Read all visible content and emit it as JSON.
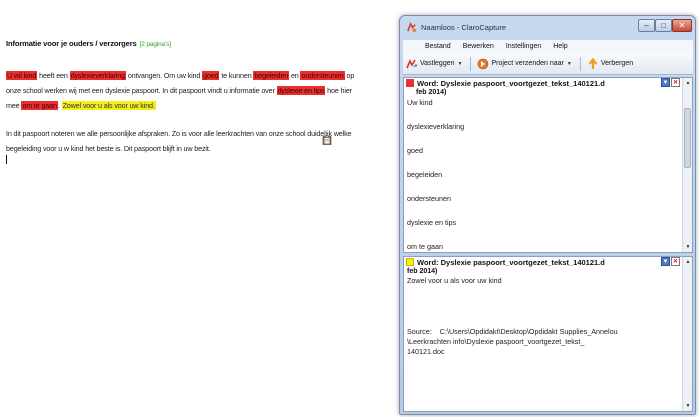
{
  "document": {
    "heading": "Informatie voor je ouders / verzorgers",
    "heading_pages": "[2 pagina's]",
    "para1": [
      {
        "text": "U wil kind",
        "hl": "red"
      },
      {
        "text": " heeft een ",
        "hl": ""
      },
      {
        "text": "dyslexieverklaring",
        "hl": "red"
      },
      {
        "text": " ontvangen. Om uw kind ",
        "hl": ""
      },
      {
        "text": "goed",
        "hl": "red"
      },
      {
        "text": " te kunnen ",
        "hl": ""
      },
      {
        "text": "begeleiden",
        "hl": "red"
      },
      {
        "text": " en ",
        "hl": ""
      },
      {
        "text": "ondersteunen",
        "hl": "red"
      },
      {
        "text": " op onze school werken wij met een dyslexie paspoort. In dit paspoort vindt u informatie over ",
        "hl": ""
      },
      {
        "text": "dyslexie en tips",
        "hl": "red"
      },
      {
        "text": " hoe hier mee ",
        "hl": ""
      },
      {
        "text": "om te gaan",
        "hl": "red"
      },
      {
        "text": ". ",
        "hl": ""
      },
      {
        "text": "Zowel voor u als voor uw kind.",
        "hl": "yellow"
      }
    ],
    "para2": "In dit paspoort noteren we alle persoonlijke afspraken. Zo is voor alle leerkrachten van onze school duidelijk welke begeleiding voor u w kind het beste is. Dit paspoort blijft in uw bezit."
  },
  "window": {
    "title": "Naamloos - ClaroCapture",
    "menu": [
      "Bestand",
      "Bewerken",
      "Instellingen",
      "Help"
    ],
    "toolbar": {
      "capture_label": "Vastleggen",
      "send_label": "Project verzenden naar",
      "hide_label": "Verbergen"
    },
    "panel1": {
      "color": "red",
      "title": "Word: Dyslexie paspoort_voortgezet_tekst_140121.d",
      "title_cont": "feb 2014)",
      "items": [
        "Uw kind",
        "dyslexieverklaring",
        "goed",
        "begeleiden",
        "ondersteunen",
        "dyslexie en tips",
        "om te gaan"
      ]
    },
    "panel2": {
      "color": "yellow",
      "title": "Word: Dyslexie paspoort_voortgezet_tekst_140121.d",
      "title_cont": "feb 2014)",
      "text": "Zowel voor u als voor uw kind",
      "source_label": "Source:",
      "source_path_1": "C:\\Users\\Opdidakt\\Desktop\\Opdidakt Supplies_Annelou",
      "source_path_2": "\\Leerkrachten info\\Dyslexie paspoort_voortgezet_tekst_",
      "source_path_3": "140121.doc"
    }
  },
  "colors": {
    "highlight_red": "#e8302e",
    "highlight_yellow": "#f3ee1c",
    "heading_pages_green": "#2ea02e"
  }
}
